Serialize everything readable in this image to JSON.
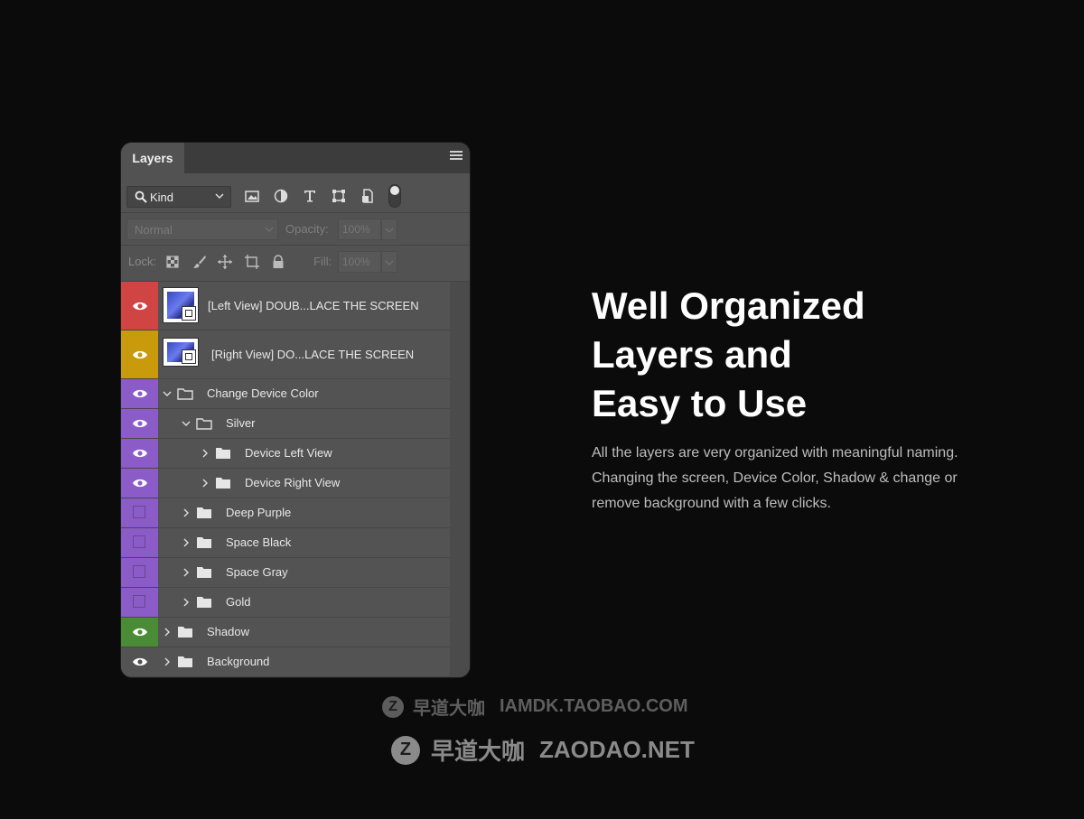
{
  "panel": {
    "tab_label": "Layers",
    "filter": {
      "kind_label": "Kind"
    },
    "blend_mode": "Normal",
    "opacity_label": "Opacity:",
    "opacity_value": "100%",
    "lock_label": "Lock:",
    "fill_label": "Fill:",
    "fill_value": "100%"
  },
  "layers": [
    {
      "name": "[Left View] DOUB...LACE THE SCREEN",
      "type": "smart",
      "visible": true,
      "color": "#d04444"
    },
    {
      "name": "[Right View] DO...LACE THE SCREEN",
      "type": "smart",
      "visible": true,
      "color": "#c99a0c"
    },
    {
      "name": "Change Device Color",
      "type": "group",
      "expanded": true,
      "visible": true,
      "color": "#8b5cc7",
      "depth": 0
    },
    {
      "name": "Silver",
      "type": "group",
      "expanded": true,
      "visible": true,
      "color": "#8b5cc7",
      "depth": 1
    },
    {
      "name": "Device Left View",
      "type": "group",
      "expanded": false,
      "visible": true,
      "color": "#8b5cc7",
      "depth": 2
    },
    {
      "name": "Device Right View",
      "type": "group",
      "expanded": false,
      "visible": true,
      "color": "#8b5cc7",
      "depth": 2
    },
    {
      "name": "Deep Purple",
      "type": "group",
      "expanded": false,
      "visible": false,
      "color": "#8b5cc7",
      "depth": 1
    },
    {
      "name": "Space Black",
      "type": "group",
      "expanded": false,
      "visible": false,
      "color": "#8b5cc7",
      "depth": 1
    },
    {
      "name": "Space Gray",
      "type": "group",
      "expanded": false,
      "visible": false,
      "color": "#8b5cc7",
      "depth": 1
    },
    {
      "name": "Gold",
      "type": "group",
      "expanded": false,
      "visible": false,
      "color": "#8b5cc7",
      "depth": 1
    },
    {
      "name": "Shadow",
      "type": "group",
      "expanded": false,
      "visible": true,
      "color": "#4a8c35",
      "depth": 0
    },
    {
      "name": "Background",
      "type": "group",
      "expanded": false,
      "visible": true,
      "color": "#535353",
      "depth": 0
    }
  ],
  "headline": [
    "Well Organized",
    "Layers and",
    "Easy to Use"
  ],
  "description": "All the layers are very organized with meaningful naming. Changing the screen, Device Color, Shadow & change or remove background with a few clicks.",
  "watermarks": [
    {
      "logo": "Z",
      "cn": "早道大咖",
      "url": "IAMDK.TAOBAO.COM"
    },
    {
      "logo": "Z",
      "cn": "早道大咖",
      "url": "ZAODAO.NET"
    }
  ]
}
